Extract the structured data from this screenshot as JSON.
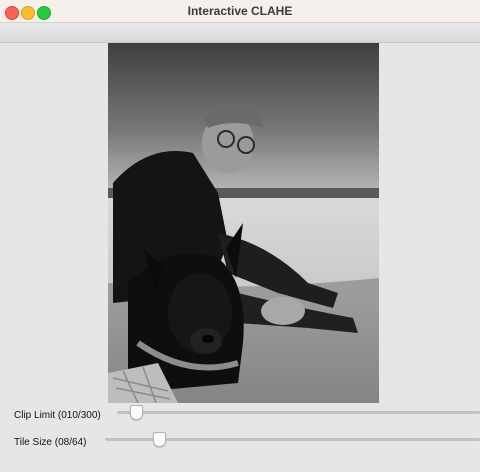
{
  "window": {
    "title": "Interactive CLAHE"
  },
  "image": {
    "icon": "photo-icon"
  },
  "controls": {
    "clip_limit": {
      "label": "Clip Limit (010/300)",
      "value": 10,
      "max": 300
    },
    "tile_size": {
      "label": "Tile Size  (08/64)",
      "value": 8,
      "max": 64
    }
  }
}
